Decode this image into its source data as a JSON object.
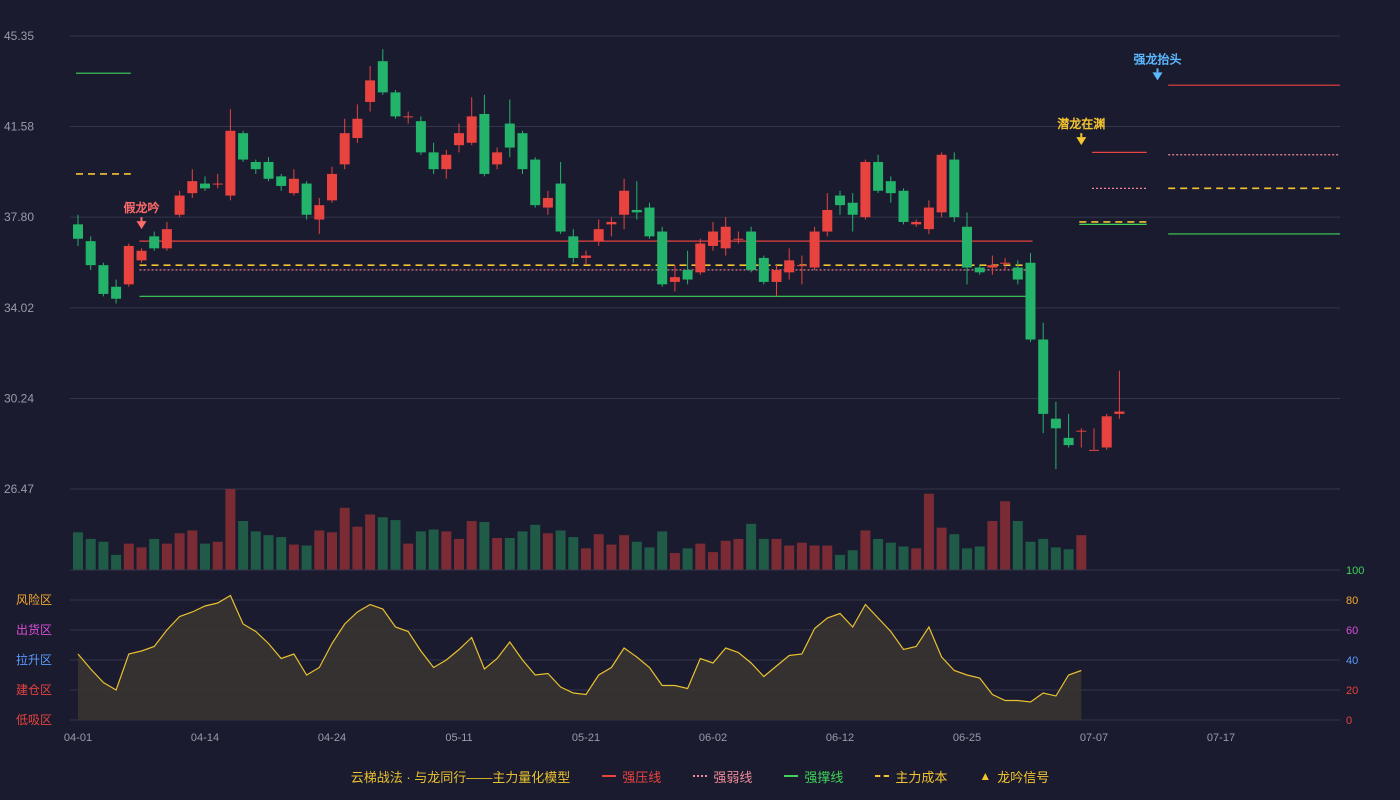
{
  "colors": {
    "background": "#1a1b2e",
    "grid": "#34364c",
    "axis_text": "#9a9cab",
    "up": "#e8433f",
    "up_fill": "#e8433f",
    "down": "#23b36b",
    "down_fill": "#23b36b",
    "vol_up": "#7a2b34",
    "vol_down": "#1f5b46",
    "pressure": "#e8433f",
    "weak": "#f08a9a",
    "support": "#3fd35a",
    "cost": "#f4c430",
    "signal_gold": "#f4c430",
    "signal_red": "#ff6b6b",
    "signal_blue": "#5ab8ff",
    "osc_line": "#e8c030",
    "osc_fill": "#3a3530"
  },
  "chart_data": [
    {
      "type": "candlestick",
      "y_ticks": [
        "45.35",
        "41.58",
        "37.80",
        "34.02",
        "30.24",
        "26.47"
      ],
      "ylim": [
        26.47,
        45.35
      ],
      "x_tick_labels": [
        "04-01",
        "04-14",
        "04-24",
        "05-11",
        "05-21",
        "06-02",
        "06-12",
        "06-25",
        "07-07",
        "07-17"
      ],
      "x_tick_index": [
        0,
        10,
        20,
        30,
        40,
        50,
        60,
        70,
        80,
        90
      ],
      "candles": [
        [
          37.5,
          36.9,
          36.6,
          37.9
        ],
        [
          36.8,
          35.8,
          35.6,
          37.0
        ],
        [
          35.8,
          34.6,
          34.5,
          35.9
        ],
        [
          34.9,
          34.4,
          34.2,
          35.2
        ],
        [
          35.0,
          36.6,
          34.9,
          36.7
        ],
        [
          36.0,
          36.4,
          35.9,
          36.5
        ],
        [
          37.0,
          36.5,
          36.4,
          37.2
        ],
        [
          36.5,
          37.3,
          36.4,
          37.6
        ],
        [
          37.9,
          38.7,
          37.8,
          38.9
        ],
        [
          38.8,
          39.3,
          38.6,
          39.8
        ],
        [
          39.2,
          39.0,
          38.9,
          39.5
        ],
        [
          39.2,
          39.2,
          39.0,
          39.6
        ],
        [
          38.7,
          41.4,
          38.5,
          42.3
        ],
        [
          41.3,
          40.2,
          40.1,
          41.4
        ],
        [
          40.1,
          39.8,
          39.6,
          40.2
        ],
        [
          40.1,
          39.4,
          39.3,
          40.3
        ],
        [
          39.5,
          39.1,
          38.9,
          39.6
        ],
        [
          38.8,
          39.4,
          38.7,
          39.8
        ],
        [
          39.2,
          37.9,
          37.7,
          39.3
        ],
        [
          37.7,
          38.3,
          37.1,
          38.6
        ],
        [
          38.5,
          39.6,
          38.4,
          39.9
        ],
        [
          40.0,
          41.3,
          39.8,
          41.9
        ],
        [
          41.1,
          41.9,
          40.9,
          42.5
        ],
        [
          42.6,
          43.5,
          42.2,
          44.1
        ],
        [
          44.3,
          43.0,
          42.9,
          44.8
        ],
        [
          43.0,
          42.0,
          41.9,
          43.1
        ],
        [
          42.0,
          42.0,
          41.7,
          42.2
        ],
        [
          41.8,
          40.5,
          40.4,
          42.0
        ],
        [
          40.5,
          39.8,
          39.6,
          40.9
        ],
        [
          39.8,
          40.4,
          39.4,
          40.6
        ],
        [
          40.8,
          41.3,
          40.5,
          41.7
        ],
        [
          40.9,
          42.0,
          40.8,
          42.8
        ],
        [
          42.1,
          39.6,
          39.5,
          42.9
        ],
        [
          40.0,
          40.5,
          39.8,
          40.7
        ],
        [
          41.7,
          40.7,
          40.3,
          42.7
        ],
        [
          41.3,
          39.8,
          39.6,
          41.4
        ],
        [
          40.2,
          38.3,
          38.2,
          40.3
        ],
        [
          38.2,
          38.6,
          37.9,
          38.9
        ],
        [
          39.2,
          37.2,
          37.1,
          40.1
        ],
        [
          37.0,
          36.1,
          35.9,
          37.3
        ],
        [
          36.1,
          36.2,
          35.8,
          36.4
        ],
        [
          36.8,
          37.3,
          36.6,
          37.7
        ],
        [
          37.5,
          37.6,
          37.0,
          37.8
        ],
        [
          37.9,
          38.9,
          37.3,
          39.4
        ],
        [
          38.1,
          38.0,
          37.7,
          39.3
        ],
        [
          38.2,
          37.0,
          36.9,
          38.4
        ],
        [
          37.2,
          35.0,
          34.9,
          37.4
        ],
        [
          35.1,
          35.3,
          34.7,
          35.8
        ],
        [
          35.6,
          35.2,
          35.0,
          36.4
        ],
        [
          35.5,
          36.7,
          35.4,
          36.9
        ],
        [
          36.6,
          37.2,
          36.4,
          37.6
        ],
        [
          36.5,
          37.4,
          36.2,
          37.8
        ],
        [
          36.9,
          36.9,
          36.7,
          37.2
        ],
        [
          37.2,
          35.6,
          35.5,
          37.4
        ],
        [
          36.1,
          35.1,
          35.0,
          36.2
        ],
        [
          35.1,
          35.6,
          34.5,
          35.8
        ],
        [
          35.5,
          36.0,
          35.2,
          36.5
        ],
        [
          35.8,
          35.8,
          35.0,
          36.2
        ],
        [
          35.7,
          37.2,
          35.6,
          37.4
        ],
        [
          37.2,
          38.1,
          37.0,
          38.8
        ],
        [
          38.7,
          38.3,
          37.9,
          38.9
        ],
        [
          38.4,
          37.9,
          37.2,
          38.8
        ],
        [
          37.8,
          40.1,
          37.7,
          40.2
        ],
        [
          40.1,
          38.9,
          38.8,
          40.4
        ],
        [
          39.3,
          38.8,
          38.4,
          39.5
        ],
        [
          38.9,
          37.6,
          37.5,
          39.0
        ],
        [
          37.5,
          37.6,
          37.4,
          37.7
        ],
        [
          37.3,
          38.2,
          37.1,
          38.5
        ],
        [
          38.0,
          40.4,
          37.8,
          40.5
        ],
        [
          40.2,
          37.8,
          37.6,
          40.5
        ],
        [
          37.4,
          35.7,
          35.0,
          38.0
        ],
        [
          35.7,
          35.5,
          35.4,
          35.8
        ],
        [
          35.7,
          35.8,
          35.4,
          36.2
        ],
        [
          35.9,
          35.9,
          35.6,
          36.1
        ],
        [
          35.7,
          35.2,
          35.0,
          36.0
        ],
        [
          35.9,
          32.7,
          32.6,
          36.3
        ],
        [
          32.7,
          29.6,
          28.8,
          33.4
        ],
        [
          29.4,
          29.0,
          27.3,
          30.1
        ],
        [
          28.6,
          28.3,
          28.2,
          29.6
        ],
        [
          28.9,
          28.9,
          28.2,
          29.0
        ],
        [
          28.1,
          28.1,
          28.1,
          29.0
        ],
        [
          28.2,
          29.5,
          28.1,
          29.6
        ],
        [
          29.6,
          29.7,
          29.4,
          31.4
        ]
      ],
      "lines": [
        {
          "name": "强压线",
          "style": "solid",
          "color_key": "pressure",
          "segments": [
            [
              5,
              75,
              36.8
            ],
            [
              80,
              84,
              40.5
            ],
            [
              86,
              100,
              43.3
            ]
          ]
        },
        {
          "name": "强弱线",
          "style": "dotted",
          "color_key": "weak",
          "segments": [
            [
              5,
              75,
              35.6
            ],
            [
              80,
              84,
              39.0
            ],
            [
              86,
              100,
              40.4
            ]
          ]
        },
        {
          "name": "强撑线",
          "style": "solid",
          "color_key": "support",
          "segments": [
            [
              0,
              4,
              43.8
            ],
            [
              5,
              75,
              34.5
            ],
            [
              79,
              84,
              37.5
            ],
            [
              86,
              100,
              37.1
            ]
          ]
        },
        {
          "name": "主力成本",
          "style": "dashed",
          "color_key": "cost",
          "segments": [
            [
              0,
              4,
              39.6
            ],
            [
              5,
              75,
              35.8
            ],
            [
              79,
              84,
              37.6
            ],
            [
              86,
              100,
              39.0
            ]
          ]
        }
      ],
      "signals": [
        {
          "index": 5,
          "price": 37.3,
          "label": "假龙吟",
          "direction": "down",
          "color_key": "signal_red"
        },
        {
          "index": 79,
          "price": 40.8,
          "label": "潜龙在渊",
          "direction": "down",
          "color_key": "signal_gold"
        },
        {
          "index": 85,
          "price": 43.5,
          "label": "强龙抬头",
          "direction": "down",
          "color_key": "signal_blue"
        }
      ]
    },
    {
      "type": "bar",
      "title": "",
      "values": [
        40,
        33,
        30,
        16,
        28,
        24,
        33,
        28,
        39,
        42,
        28,
        30,
        86,
        52,
        41,
        37,
        35,
        27,
        26,
        42,
        40,
        66,
        46,
        59,
        56,
        53,
        28,
        41,
        43,
        41,
        33,
        52,
        51,
        34,
        34,
        41,
        48,
        39,
        42,
        35,
        23,
        38,
        27,
        37,
        30,
        24,
        41,
        18,
        23,
        28,
        19,
        31,
        33,
        49,
        33,
        33,
        26,
        29,
        26,
        26,
        16,
        21,
        42,
        33,
        29,
        25,
        23,
        81,
        45,
        38,
        23,
        25,
        52,
        73,
        52,
        30,
        33,
        24,
        22,
        37
      ],
      "ylim": [
        0,
        86
      ]
    },
    {
      "type": "area",
      "y_ticks": [
        "100",
        "80",
        "60",
        "40",
        "20",
        "0"
      ],
      "ylim": [
        0,
        100
      ],
      "zones": [
        "风险区",
        "出货区",
        "拉升区",
        "建仓区",
        "低吸区"
      ],
      "values": [
        44,
        34,
        25,
        20,
        44,
        46,
        49,
        60,
        69,
        72,
        76,
        78,
        83,
        64,
        59,
        51,
        41,
        44,
        30,
        35,
        51,
        64,
        72,
        77,
        74,
        62,
        59,
        46,
        35,
        40,
        47,
        55,
        34,
        41,
        52,
        40,
        30,
        31,
        22,
        18,
        17,
        30,
        35,
        48,
        42,
        35,
        23,
        23,
        21,
        41,
        38,
        48,
        45,
        38,
        29,
        36,
        43,
        44,
        61,
        68,
        71,
        62,
        77,
        68,
        59,
        47,
        49,
        62,
        42,
        33,
        30,
        28,
        17,
        13,
        13,
        12,
        18,
        16,
        30,
        33
      ],
      "legend": [
        "云梯战法 · 与龙同行——主力量化模型",
        "强压线",
        "强弱线",
        "强撑线",
        "主力成本",
        "龙吟信号"
      ]
    }
  ]
}
